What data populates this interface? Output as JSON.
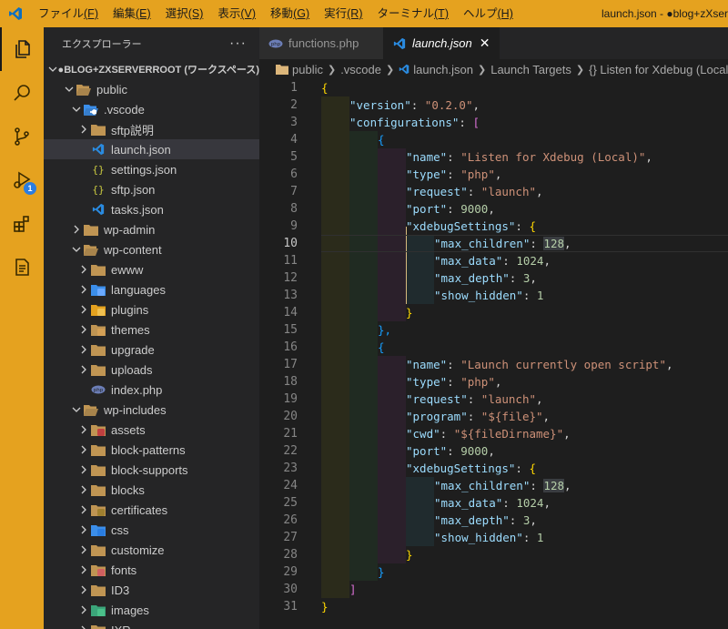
{
  "titlebar": {
    "menu": [
      {
        "label": "ファイル",
        "key": "(F)"
      },
      {
        "label": "編集",
        "key": "(E)"
      },
      {
        "label": "選択",
        "key": "(S)"
      },
      {
        "label": "表示",
        "key": "(V)"
      },
      {
        "label": "移動",
        "key": "(G)"
      },
      {
        "label": "実行",
        "key": "(R)"
      },
      {
        "label": "ターミナル",
        "key": "(T)"
      },
      {
        "label": "ヘルプ",
        "key": "(H)"
      }
    ],
    "window_title": "launch.json - ●blog+zXser"
  },
  "activity_bar": {
    "icons": [
      "files-icon",
      "search-icon",
      "source-control-icon",
      "run-debug-icon",
      "extensions-icon",
      "remote-explorer-icon"
    ],
    "debug_badge": "1",
    "accent": "#e5a21f"
  },
  "sidebar": {
    "title": "エクスプローラー",
    "more": "···",
    "root_label": "●BLOG+ZXSERVERROOT (ワークスペース)",
    "items": [
      {
        "label": "public",
        "depth": 1,
        "type": "folder-open",
        "icon": "folder-open-icon"
      },
      {
        "label": ".vscode",
        "depth": 2,
        "type": "folder-open",
        "icon": "vscode-folder-icon"
      },
      {
        "label": "sftp説明",
        "depth": 3,
        "type": "folder",
        "icon": "folder-icon"
      },
      {
        "label": "launch.json",
        "depth": 3,
        "type": "file",
        "icon": "vscode-file-icon",
        "selected": true
      },
      {
        "label": "settings.json",
        "depth": 3,
        "type": "file",
        "icon": "json-file-icon"
      },
      {
        "label": "sftp.json",
        "depth": 3,
        "type": "file",
        "icon": "json-file-icon"
      },
      {
        "label": "tasks.json",
        "depth": 3,
        "type": "file",
        "icon": "vscode-file-icon"
      },
      {
        "label": "wp-admin",
        "depth": 2,
        "type": "folder",
        "icon": "folder-icon"
      },
      {
        "label": "wp-content",
        "depth": 2,
        "type": "folder-open",
        "icon": "folder-open-icon"
      },
      {
        "label": "ewww",
        "depth": 3,
        "type": "folder",
        "icon": "folder-icon"
      },
      {
        "label": "languages",
        "depth": 3,
        "type": "folder",
        "icon": "languages-folder-icon"
      },
      {
        "label": "plugins",
        "depth": 3,
        "type": "folder",
        "icon": "plugins-folder-icon"
      },
      {
        "label": "themes",
        "depth": 3,
        "type": "folder",
        "icon": "themes-folder-icon"
      },
      {
        "label": "upgrade",
        "depth": 3,
        "type": "folder",
        "icon": "folder-icon"
      },
      {
        "label": "uploads",
        "depth": 3,
        "type": "folder",
        "icon": "folder-icon"
      },
      {
        "label": "index.php",
        "depth": 3,
        "type": "file",
        "icon": "php-file-icon"
      },
      {
        "label": "wp-includes",
        "depth": 2,
        "type": "folder-open",
        "icon": "folder-open-icon"
      },
      {
        "label": "assets",
        "depth": 3,
        "type": "folder",
        "icon": "assets-folder-icon"
      },
      {
        "label": "block-patterns",
        "depth": 3,
        "type": "folder",
        "icon": "folder-icon"
      },
      {
        "label": "block-supports",
        "depth": 3,
        "type": "folder",
        "icon": "folder-icon"
      },
      {
        "label": "blocks",
        "depth": 3,
        "type": "folder",
        "icon": "folder-icon"
      },
      {
        "label": "certificates",
        "depth": 3,
        "type": "folder",
        "icon": "certificates-folder-icon"
      },
      {
        "label": "css",
        "depth": 3,
        "type": "folder",
        "icon": "css-folder-icon"
      },
      {
        "label": "customize",
        "depth": 3,
        "type": "folder",
        "icon": "folder-icon"
      },
      {
        "label": "fonts",
        "depth": 3,
        "type": "folder",
        "icon": "fonts-folder-icon"
      },
      {
        "label": "ID3",
        "depth": 3,
        "type": "folder",
        "icon": "folder-icon"
      },
      {
        "label": "images",
        "depth": 3,
        "type": "folder",
        "icon": "images-folder-icon"
      },
      {
        "label": "IXR",
        "depth": 3,
        "type": "folder",
        "icon": "folder-icon"
      }
    ]
  },
  "tabs": [
    {
      "label": "functions.php",
      "icon": "php-file-icon",
      "active": false
    },
    {
      "label": "launch.json",
      "icon": "vscode-file-icon",
      "active": true,
      "close": "✕"
    }
  ],
  "breadcrumb": [
    "public",
    ".vscode",
    "launch.json",
    "Launch Targets",
    "{} Listen for Xdebug (Local)"
  ],
  "editor": {
    "current_line": 10,
    "lines": [
      [
        [
          "b1",
          "{"
        ]
      ],
      [
        [
          "k",
          "\"version\""
        ],
        [
          "p",
          ": "
        ],
        [
          "s",
          "\"0.2.0\""
        ],
        [
          "p",
          ","
        ]
      ],
      [
        [
          "k",
          "\"configurations\""
        ],
        [
          "p",
          ": "
        ],
        [
          "b2",
          "["
        ]
      ],
      [
        [
          "b3",
          "{"
        ]
      ],
      [
        [
          "k",
          "\"name\""
        ],
        [
          "p",
          ": "
        ],
        [
          "s",
          "\"Listen for Xdebug (Local)\""
        ],
        [
          "p",
          ","
        ]
      ],
      [
        [
          "k",
          "\"type\""
        ],
        [
          "p",
          ": "
        ],
        [
          "s",
          "\"php\""
        ],
        [
          "p",
          ","
        ]
      ],
      [
        [
          "k",
          "\"request\""
        ],
        [
          "p",
          ": "
        ],
        [
          "s",
          "\"launch\""
        ],
        [
          "p",
          ","
        ]
      ],
      [
        [
          "k",
          "\"port\""
        ],
        [
          "p",
          ": "
        ],
        [
          "n",
          "9000"
        ],
        [
          "p",
          ","
        ]
      ],
      [
        [
          "k",
          "\"xdebugSettings\""
        ],
        [
          "p",
          ": "
        ],
        [
          "b1",
          "{"
        ]
      ],
      [
        [
          "k",
          "\"max_children\""
        ],
        [
          "p",
          ": "
        ],
        [
          "nh",
          "128"
        ],
        [
          "p",
          ","
        ]
      ],
      [
        [
          "k",
          "\"max_data\""
        ],
        [
          "p",
          ": "
        ],
        [
          "n",
          "1024"
        ],
        [
          "p",
          ","
        ]
      ],
      [
        [
          "k",
          "\"max_depth\""
        ],
        [
          "p",
          ": "
        ],
        [
          "n",
          "3"
        ],
        [
          "p",
          ","
        ]
      ],
      [
        [
          "k",
          "\"show_hidden\""
        ],
        [
          "p",
          ": "
        ],
        [
          "n",
          "1"
        ]
      ],
      [
        [
          "b1",
          "}"
        ]
      ],
      [
        [
          "b3",
          "},"
        ]
      ],
      [
        [
          "b3",
          "{"
        ]
      ],
      [
        [
          "k",
          "\"name\""
        ],
        [
          "p",
          ": "
        ],
        [
          "s",
          "\"Launch currently open script\""
        ],
        [
          "p",
          ","
        ]
      ],
      [
        [
          "k",
          "\"type\""
        ],
        [
          "p",
          ": "
        ],
        [
          "s",
          "\"php\""
        ],
        [
          "p",
          ","
        ]
      ],
      [
        [
          "k",
          "\"request\""
        ],
        [
          "p",
          ": "
        ],
        [
          "s",
          "\"launch\""
        ],
        [
          "p",
          ","
        ]
      ],
      [
        [
          "k",
          "\"program\""
        ],
        [
          "p",
          ": "
        ],
        [
          "s",
          "\"${file}\""
        ],
        [
          "p",
          ","
        ]
      ],
      [
        [
          "k",
          "\"cwd\""
        ],
        [
          "p",
          ": "
        ],
        [
          "s",
          "\"${fileDirname}\""
        ],
        [
          "p",
          ","
        ]
      ],
      [
        [
          "k",
          "\"port\""
        ],
        [
          "p",
          ": "
        ],
        [
          "n",
          "9000"
        ],
        [
          "p",
          ","
        ]
      ],
      [
        [
          "k",
          "\"xdebugSettings\""
        ],
        [
          "p",
          ": "
        ],
        [
          "b1",
          "{"
        ]
      ],
      [
        [
          "k",
          "\"max_children\""
        ],
        [
          "p",
          ": "
        ],
        [
          "nh",
          "128"
        ],
        [
          "p",
          ","
        ]
      ],
      [
        [
          "k",
          "\"max_data\""
        ],
        [
          "p",
          ": "
        ],
        [
          "n",
          "1024"
        ],
        [
          "p",
          ","
        ]
      ],
      [
        [
          "k",
          "\"max_depth\""
        ],
        [
          "p",
          ": "
        ],
        [
          "n",
          "3"
        ],
        [
          "p",
          ","
        ]
      ],
      [
        [
          "k",
          "\"show_hidden\""
        ],
        [
          "p",
          ": "
        ],
        [
          "n",
          "1"
        ]
      ],
      [
        [
          "b1",
          "}"
        ]
      ],
      [
        [
          "b3",
          "}"
        ]
      ],
      [
        [
          "b2",
          "]"
        ]
      ],
      [
        [
          "b1",
          "}"
        ]
      ]
    ]
  }
}
